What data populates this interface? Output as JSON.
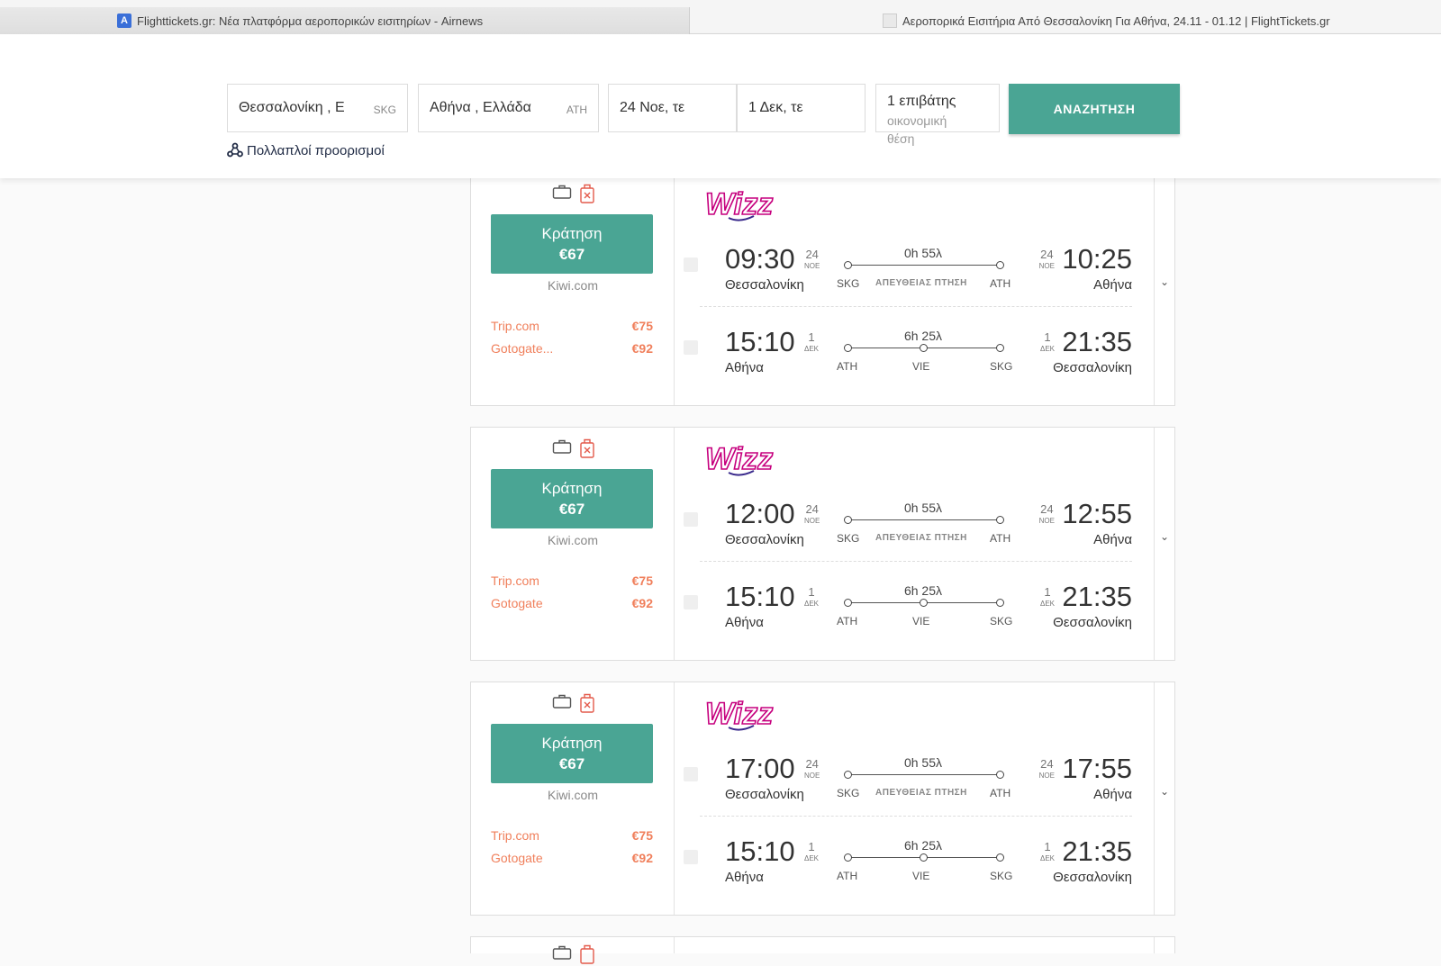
{
  "browser": {
    "active_tab_title": "Flighttickets.gr: Νέα πλατφόρμα αεροπορικών εισιτηρίων - Airnews",
    "inactive_tab_title": "Αεροπορικά Εισιτήρια Από Θεσσαλονίκη Για Αθήνα, 24.11 - 01.12 | FlightTickets.gr"
  },
  "search": {
    "origin": "Θεσσαλονίκη , Ε",
    "origin_code": "SKG",
    "destination": "Αθήνα , Ελλάδα",
    "destination_code": "ATH",
    "depart_date": "24 Νοε, τε",
    "return_date": "1 Δεκ, τε",
    "passengers": "1 επιβάτης",
    "cabin_class": "οικονομική θέση",
    "search_label": "ΑΝΑΖΗΤΗΣΗ",
    "multi_city_label": "Πολλαπλοί προορισμοί"
  },
  "colors": {
    "accent": "#4aa594",
    "alt_price": "#f07f5b",
    "wizz": "#c6007e"
  },
  "results": [
    {
      "airline": "Wizz",
      "book_label": "Κράτηση",
      "price": "€67",
      "provider": "Kiwi.com",
      "alternatives": [
        {
          "name": "Trip.com",
          "price": "€75"
        },
        {
          "name": "Gotogate...",
          "price": "€92"
        }
      ],
      "outbound": {
        "dep_time": "09:30",
        "dep_day": "24",
        "dep_month": "ΝΟΕ",
        "dep_city": "Θεσσαλονίκη",
        "arr_time": "10:25",
        "arr_day": "24",
        "arr_month": "ΝΟΕ",
        "arr_city": "Αθήνα",
        "duration": "0h 55λ",
        "from": "SKG",
        "to": "ATH",
        "stop_label": "ΑΠΕΥΘΕΙΑΣ ΠΤΗΣΗ"
      },
      "inbound": {
        "dep_time": "15:10",
        "dep_day": "1",
        "dep_month": "ΔΕΚ",
        "dep_city": "Αθήνα",
        "arr_time": "21:35",
        "arr_day": "1",
        "arr_month": "ΔΕΚ",
        "arr_city": "Θεσσαλονίκη",
        "duration": "6h 25λ",
        "from": "ATH",
        "via": "VIE",
        "to": "SKG"
      }
    },
    {
      "airline": "Wizz",
      "book_label": "Κράτηση",
      "price": "€67",
      "provider": "Kiwi.com",
      "alternatives": [
        {
          "name": "Trip.com",
          "price": "€75"
        },
        {
          "name": "Gotogate",
          "price": "€92"
        }
      ],
      "outbound": {
        "dep_time": "12:00",
        "dep_day": "24",
        "dep_month": "ΝΟΕ",
        "dep_city": "Θεσσαλονίκη",
        "arr_time": "12:55",
        "arr_day": "24",
        "arr_month": "ΝΟΕ",
        "arr_city": "Αθήνα",
        "duration": "0h 55λ",
        "from": "SKG",
        "to": "ATH",
        "stop_label": "ΑΠΕΥΘΕΙΑΣ ΠΤΗΣΗ"
      },
      "inbound": {
        "dep_time": "15:10",
        "dep_day": "1",
        "dep_month": "ΔΕΚ",
        "dep_city": "Αθήνα",
        "arr_time": "21:35",
        "arr_day": "1",
        "arr_month": "ΔΕΚ",
        "arr_city": "Θεσσαλονίκη",
        "duration": "6h 25λ",
        "from": "ATH",
        "via": "VIE",
        "to": "SKG"
      }
    },
    {
      "airline": "Wizz",
      "book_label": "Κράτηση",
      "price": "€67",
      "provider": "Kiwi.com",
      "alternatives": [
        {
          "name": "Trip.com",
          "price": "€75"
        },
        {
          "name": "Gotogate",
          "price": "€92"
        }
      ],
      "outbound": {
        "dep_time": "17:00",
        "dep_day": "24",
        "dep_month": "ΝΟΕ",
        "dep_city": "Θεσσαλονίκη",
        "arr_time": "17:55",
        "arr_day": "24",
        "arr_month": "ΝΟΕ",
        "arr_city": "Αθήνα",
        "duration": "0h 55λ",
        "from": "SKG",
        "to": "ATH",
        "stop_label": "ΑΠΕΥΘΕΙΑΣ ΠΤΗΣΗ"
      },
      "inbound": {
        "dep_time": "15:10",
        "dep_day": "1",
        "dep_month": "ΔΕΚ",
        "dep_city": "Αθήνα",
        "arr_time": "21:35",
        "arr_day": "1",
        "arr_month": "ΔΕΚ",
        "arr_city": "Θεσσαλονίκη",
        "duration": "6h 25λ",
        "from": "ATH",
        "via": "VIE",
        "to": "SKG"
      }
    }
  ]
}
